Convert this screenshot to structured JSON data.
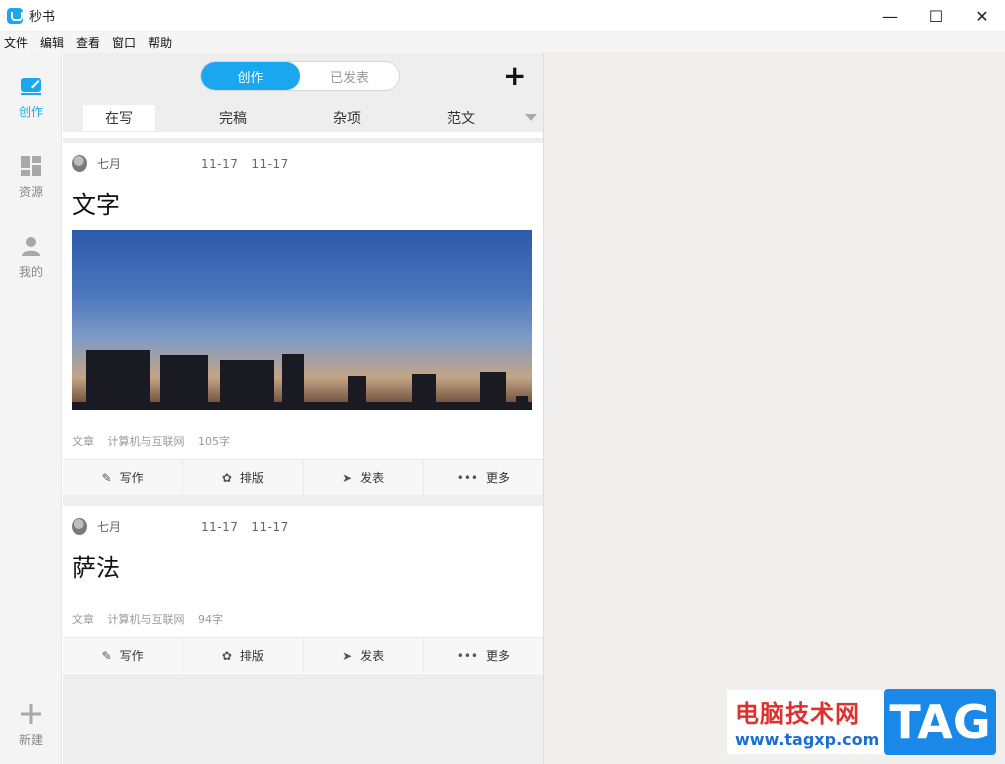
{
  "window": {
    "title": "秒书",
    "controls": {
      "minimize": "—",
      "maximize": "☐",
      "close": "✕"
    }
  },
  "menu": [
    "文件",
    "编辑",
    "查看",
    "窗口",
    "帮助"
  ],
  "nav": [
    {
      "label": "创作",
      "icon": "pen-icon",
      "active": true
    },
    {
      "label": "资源",
      "icon": "grid-icon",
      "active": false
    },
    {
      "label": "我的",
      "icon": "user-icon",
      "active": false
    }
  ],
  "nav_new": {
    "label": "新建",
    "icon": "plus-icon"
  },
  "toggle": {
    "left": "创作",
    "right": "已发表"
  },
  "add_button": "+",
  "tabs": [
    "在写",
    "完稿",
    "杂项",
    "范文"
  ],
  "cards": [
    {
      "author": "七月",
      "date1": "11-17",
      "date2": "11-17",
      "title": "文字",
      "has_image": true,
      "type": "文章",
      "category": "计算机与互联网",
      "words": "105字"
    },
    {
      "author": "七月",
      "date1": "11-17",
      "date2": "11-17",
      "title": "萨法",
      "has_image": false,
      "type": "文章",
      "category": "计算机与互联网",
      "words": "94字"
    }
  ],
  "actions": {
    "write": "写作",
    "layout": "排版",
    "publish": "发表",
    "more": "更多"
  },
  "watermark": {
    "cn": "电脑技术网",
    "url": "www.tagxp.com",
    "tag": "TAG"
  },
  "colors": {
    "accent": "#1aa7f0",
    "watermark_red": "#e0302d",
    "watermark_blue": "#1a88e8"
  }
}
